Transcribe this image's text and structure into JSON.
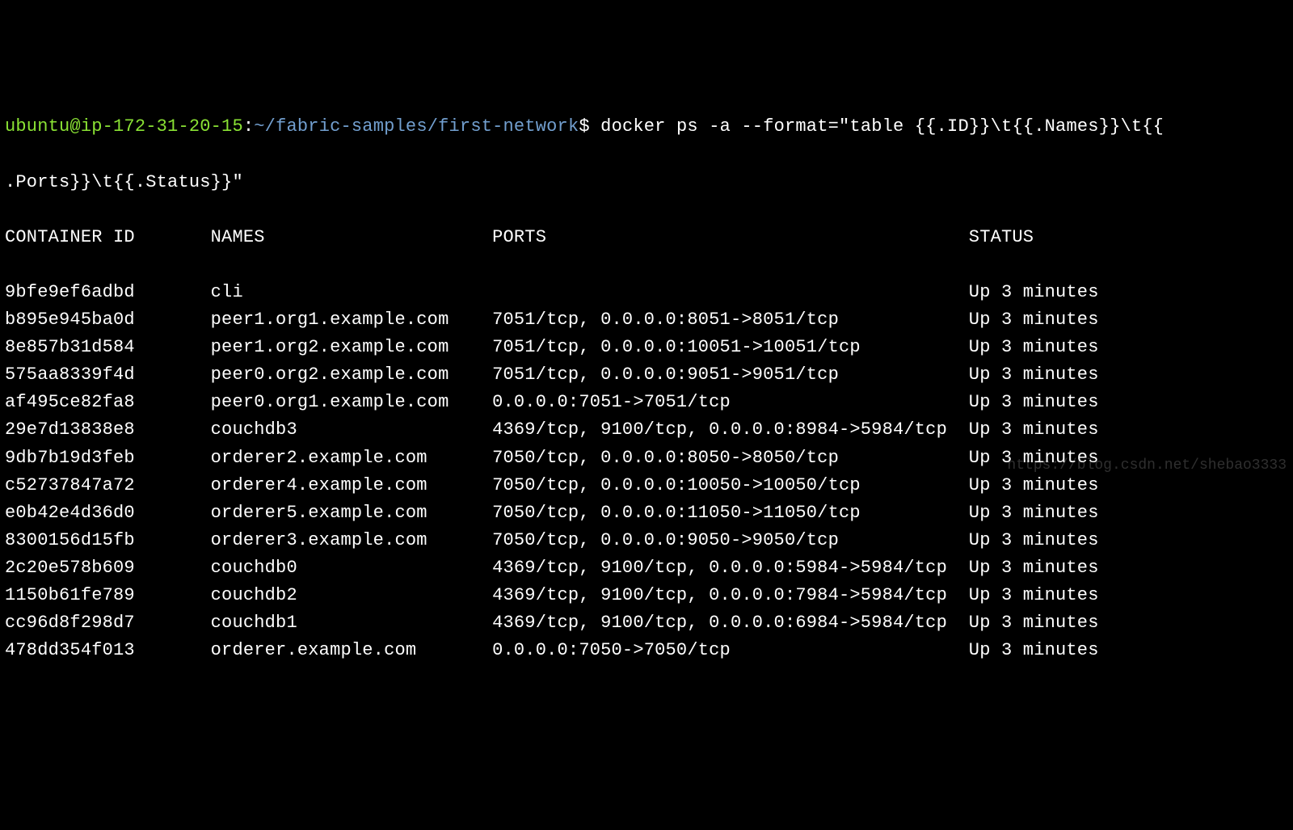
{
  "prompt": {
    "user": "ubuntu",
    "at": "@",
    "host": "ip-172-31-20-15",
    "colon": ":",
    "path": "~/fabric-samples/first-network",
    "dollar": "$"
  },
  "command_line1": " docker ps -a --format=\"table {{.ID}}\\t{{.Names}}\\t{{",
  "command_line2": ".Ports}}\\t{{.Status}}\"",
  "headers": {
    "id": "CONTAINER ID",
    "names": "NAMES",
    "ports": "PORTS",
    "status": "STATUS"
  },
  "rows": [
    {
      "id": "9bfe9ef6adbd",
      "name": "cli",
      "ports": "",
      "status": "Up 3 minutes"
    },
    {
      "id": "b895e945ba0d",
      "name": "peer1.org1.example.com",
      "ports": "7051/tcp, 0.0.0.0:8051->8051/tcp",
      "status": "Up 3 minutes"
    },
    {
      "id": "8e857b31d584",
      "name": "peer1.org2.example.com",
      "ports": "7051/tcp, 0.0.0.0:10051->10051/tcp",
      "status": "Up 3 minutes"
    },
    {
      "id": "575aa8339f4d",
      "name": "peer0.org2.example.com",
      "ports": "7051/tcp, 0.0.0.0:9051->9051/tcp",
      "status": "Up 3 minutes"
    },
    {
      "id": "af495ce82fa8",
      "name": "peer0.org1.example.com",
      "ports": "0.0.0.0:7051->7051/tcp",
      "status": "Up 3 minutes"
    },
    {
      "id": "29e7d13838e8",
      "name": "couchdb3",
      "ports": "4369/tcp, 9100/tcp, 0.0.0.0:8984->5984/tcp",
      "status": "Up 3 minutes"
    },
    {
      "id": "9db7b19d3feb",
      "name": "orderer2.example.com",
      "ports": "7050/tcp, 0.0.0.0:8050->8050/tcp",
      "status": "Up 3 minutes"
    },
    {
      "id": "c52737847a72",
      "name": "orderer4.example.com",
      "ports": "7050/tcp, 0.0.0.0:10050->10050/tcp",
      "status": "Up 3 minutes"
    },
    {
      "id": "e0b42e4d36d0",
      "name": "orderer5.example.com",
      "ports": "7050/tcp, 0.0.0.0:11050->11050/tcp",
      "status": "Up 3 minutes"
    },
    {
      "id": "8300156d15fb",
      "name": "orderer3.example.com",
      "ports": "7050/tcp, 0.0.0.0:9050->9050/tcp",
      "status": "Up 3 minutes"
    },
    {
      "id": "2c20e578b609",
      "name": "couchdb0",
      "ports": "4369/tcp, 9100/tcp, 0.0.0.0:5984->5984/tcp",
      "status": "Up 3 minutes"
    },
    {
      "id": "1150b61fe789",
      "name": "couchdb2",
      "ports": "4369/tcp, 9100/tcp, 0.0.0.0:7984->5984/tcp",
      "status": "Up 3 minutes"
    },
    {
      "id": "cc96d8f298d7",
      "name": "couchdb1",
      "ports": "4369/tcp, 9100/tcp, 0.0.0.0:6984->5984/tcp",
      "status": "Up 3 minutes"
    },
    {
      "id": "478dd354f013",
      "name": "orderer.example.com",
      "ports": "0.0.0.0:7050->7050/tcp",
      "status": "Up 3 minutes"
    }
  ],
  "watermark": "https://blog.csdn.net/shebao3333",
  "col_widths": {
    "id": 19,
    "name": 26,
    "ports": 44
  }
}
